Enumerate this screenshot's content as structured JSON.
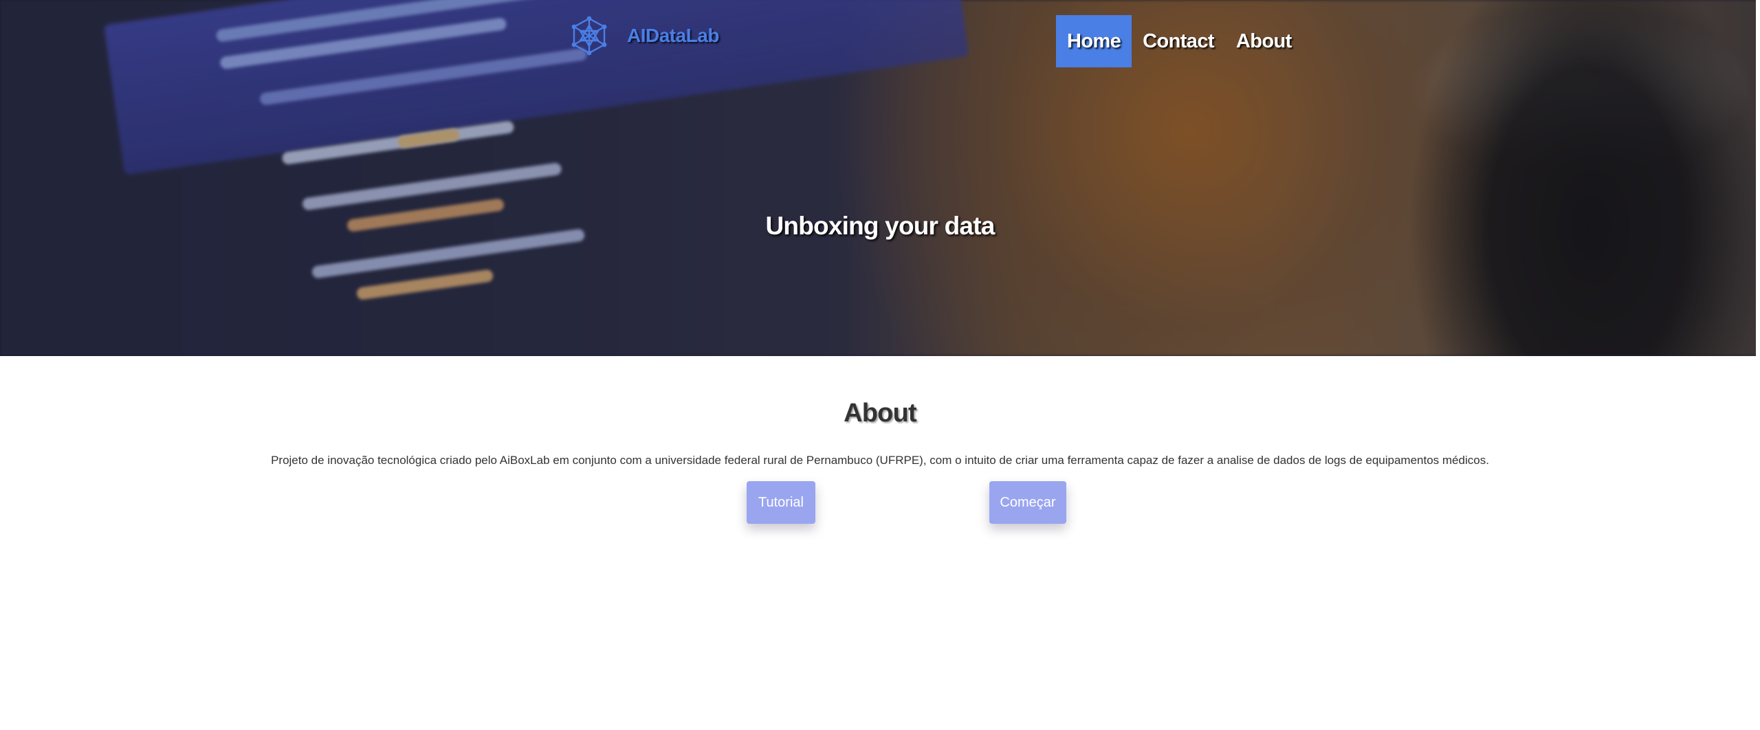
{
  "brand": {
    "name": "AIDataLab",
    "icon": "molecule-network-icon",
    "color": "#4a7fe6"
  },
  "nav": {
    "items": [
      {
        "label": "Home",
        "active": true
      },
      {
        "label": "Contact",
        "active": false
      },
      {
        "label": "About",
        "active": false
      }
    ],
    "active_color": "#4a7fe6"
  },
  "hero": {
    "title": "Unboxing your data"
  },
  "about": {
    "title": "About",
    "text": "Projeto de inovação tecnológica criado pelo AiBoxLab em conjunto com a universidade federal rural de Pernambuco (UFRPE), com o intuito de criar uma ferramenta capaz de fazer a analise de dados de logs de equipamentos médicos.",
    "buttons": {
      "tutorial_label": "Tutorial",
      "start_label": "Começar"
    },
    "button_color": "#9aa5f0"
  }
}
